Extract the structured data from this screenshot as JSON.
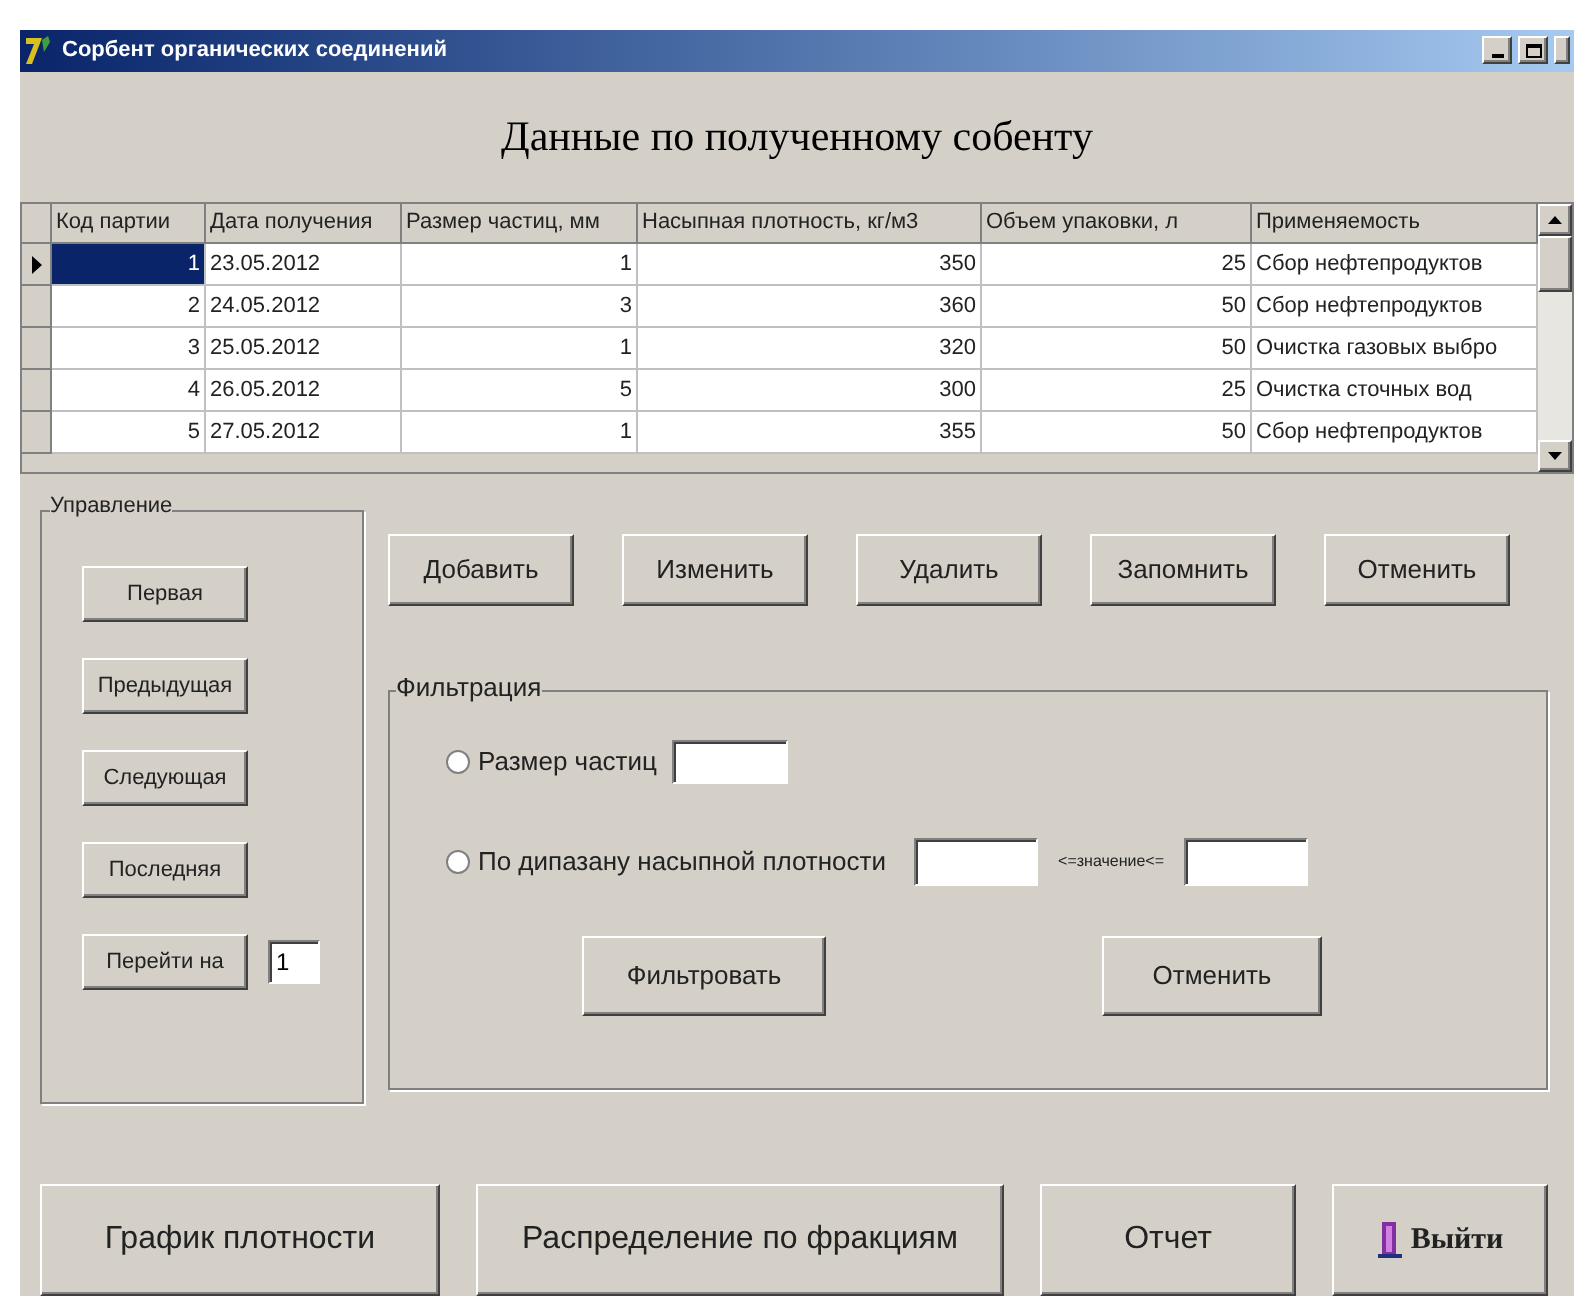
{
  "window": {
    "title": "Сорбент органических соединений"
  },
  "heading": "Данные по полученному собенту",
  "table": {
    "columns": [
      "Код партии",
      "Дата получения",
      "Размер частиц, мм",
      "Насыпная плотность, кг/м3",
      "Объем упаковки, л",
      "Применяемость"
    ],
    "rows": [
      {
        "selected": true,
        "cells": [
          "1",
          "23.05.2012",
          "1",
          "350",
          "25",
          "Сбор нефтепродуктов"
        ]
      },
      {
        "selected": false,
        "cells": [
          "2",
          "24.05.2012",
          "3",
          "360",
          "50",
          "Сбор нефтепродуктов"
        ]
      },
      {
        "selected": false,
        "cells": [
          "3",
          "25.05.2012",
          "1",
          "320",
          "50",
          "Очистка газовых выбро"
        ]
      },
      {
        "selected": false,
        "cells": [
          "4",
          "26.05.2012",
          "5",
          "300",
          "25",
          "Очистка сточных вод"
        ]
      },
      {
        "selected": false,
        "cells": [
          "5",
          "27.05.2012",
          "1",
          "355",
          "50",
          "Сбор нефтепродуктов"
        ]
      }
    ]
  },
  "navigation": {
    "title": "Управление",
    "buttons": [
      "Первая",
      "Предыдущая",
      "Следующая",
      "Последняя",
      "Перейти на"
    ],
    "goto_value": "1"
  },
  "actions": [
    "Добавить",
    "Изменить",
    "Удалить",
    "Запомнить",
    "Отменить"
  ],
  "filter": {
    "title": "Фильтрация",
    "particle_size": {
      "label": "Размер частиц",
      "checked": false
    },
    "density_range": {
      "label": "По дипазану насыпной плотности",
      "checked": false,
      "between": "<=значение<="
    },
    "apply": "Фильтровать",
    "cancel": "Отменить"
  },
  "bottom_buttons": [
    {
      "label": "График плотности",
      "icon": false
    },
    {
      "label": "Распределение по фракциям",
      "icon": false
    },
    {
      "label": "Отчет",
      "icon": false
    },
    {
      "label": "Выйти",
      "icon": true
    }
  ]
}
